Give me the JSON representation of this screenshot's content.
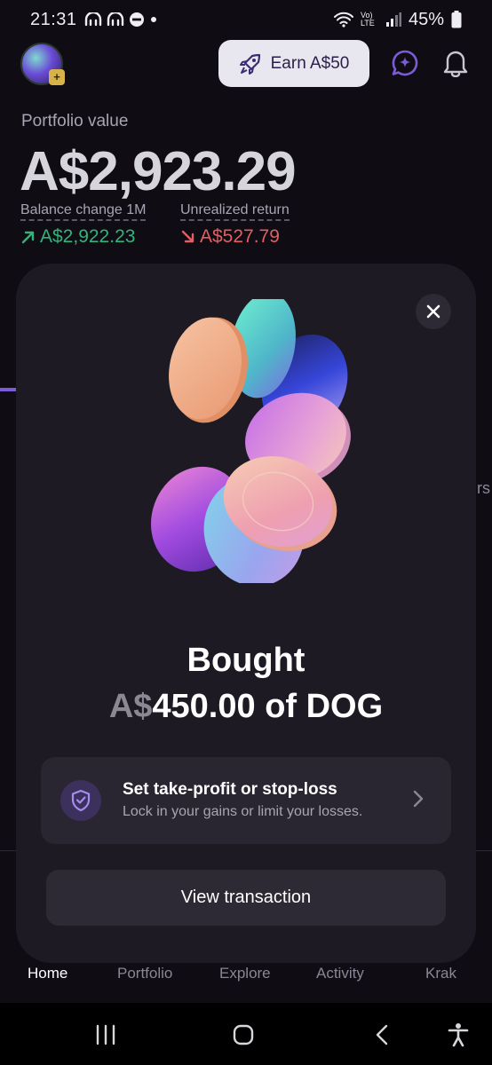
{
  "status_bar": {
    "time": "21:31",
    "battery": "45%",
    "network_label": "Vo) LTE"
  },
  "header": {
    "earn_label": "Earn A$50",
    "icons": [
      "avatar",
      "rocket-icon",
      "chat-sparkle-icon",
      "bell-icon"
    ]
  },
  "portfolio": {
    "label": "Portfolio value",
    "value": "A$2,923.29",
    "balance_change_label": "Balance change 1M",
    "balance_change_value": "A$2,922.23",
    "unrealized_label": "Unrealized return",
    "unrealized_value": "A$527.79"
  },
  "background_fragment": {
    "edge_text": "rs"
  },
  "modal": {
    "title": "Bought",
    "amount_currency": "A$",
    "amount_rest": "450.00 of DOG",
    "option_title": "Set take-profit or stop-loss",
    "option_subtitle": "Lock in your gains or limit your losses.",
    "view_button": "View transaction"
  },
  "bottom_nav": {
    "items": [
      "Home",
      "Portfolio",
      "Explore",
      "Activity",
      "Krak"
    ],
    "active": "Home"
  },
  "colors": {
    "accent_purple": "#7b5cd6",
    "positive": "#32b37a",
    "negative": "#e05f63",
    "modal_bg": "#1d1a23"
  }
}
